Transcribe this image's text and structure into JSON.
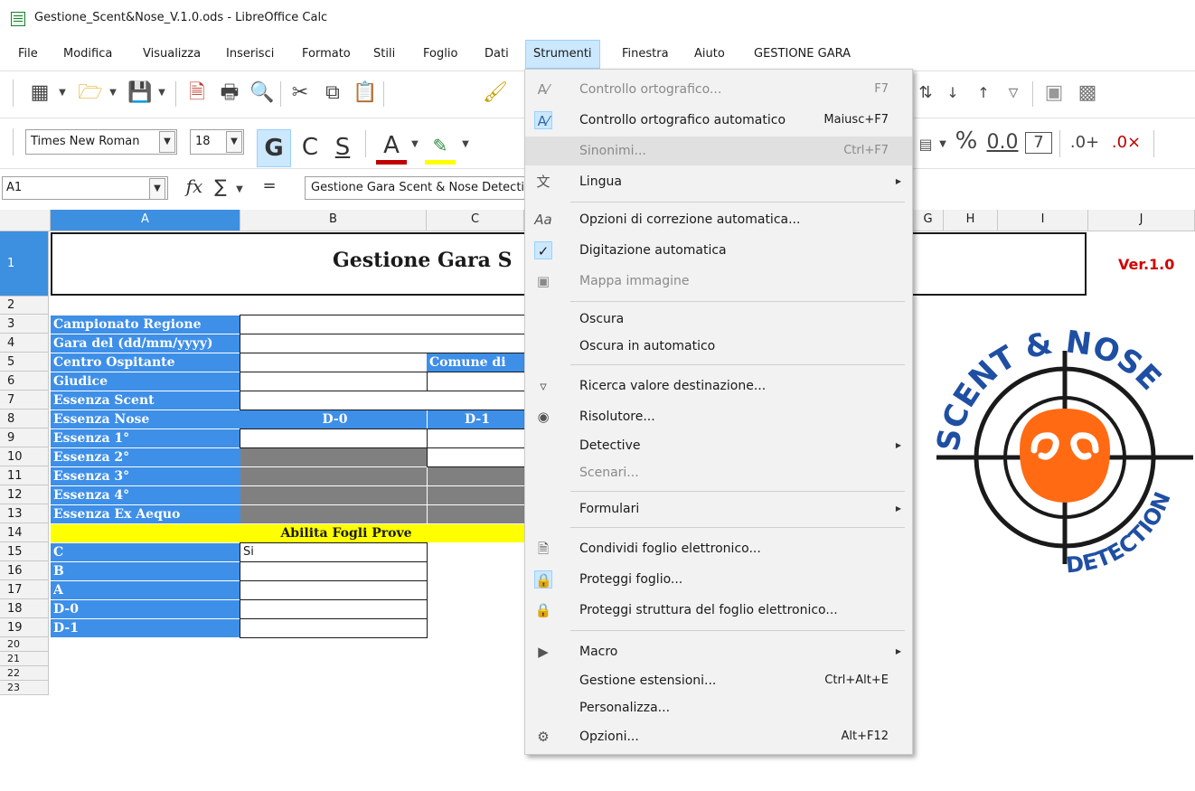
{
  "window": {
    "title": "Gestione_Scent&Nose_V.1.0.ods - LibreOffice Calc"
  },
  "menubar": [
    "File",
    "Modifica",
    "Visualizza",
    "Inserisci",
    "Formato",
    "Stili",
    "Foglio",
    "Dati",
    "Strumenti",
    "Finestra",
    "Aiuto",
    "GESTIONE GARA"
  ],
  "toolbar": {
    "font_name": "Times New Roman",
    "font_size": "18",
    "bold_label": "G",
    "italic_label": "C",
    "underline_label": "S",
    "percent_label": "%",
    "decimal_label": "0.0"
  },
  "formula_bar": {
    "cell_ref": "A1",
    "content": "Gestione Gara Scent & Nose Detection"
  },
  "columns": [
    "A",
    "B",
    "C",
    "G",
    "H",
    "I",
    "J"
  ],
  "rows": [
    "1",
    "2",
    "3",
    "4",
    "5",
    "6",
    "7",
    "8",
    "9",
    "10",
    "11",
    "12",
    "13",
    "14",
    "15",
    "16",
    "17",
    "18",
    "19",
    "20",
    "21",
    "22",
    "23"
  ],
  "sheet": {
    "title": "Gestione Gara S",
    "version": "Ver.1.0",
    "labels": {
      "r3": "Campionato Regione",
      "r4": "Gara del (dd/mm/yyyy)",
      "r5": "Centro Ospitante",
      "r5c": "Comune di",
      "r6": "Giudice",
      "r7": "Essenza Scent",
      "r8": "Essenza Nose",
      "r8b": "D-0",
      "r8c": "D-1",
      "r9": "Essenza 1°",
      "r10": "Essenza 2°",
      "r11": "Essenza 3°",
      "r12": "Essenza 4°",
      "r13": "Essenza Ex Aequo",
      "r14": "Abilita Fogli Prove",
      "r15": "C",
      "r15b": "Si",
      "r16": "B",
      "r17": "A",
      "r18": "D-0",
      "r19": "D-1"
    }
  },
  "logo": {
    "top_text": "SCENT & NOSE",
    "bottom_text": "DETECTION",
    "accent": "#ff6a13",
    "text_color": "#1f4fa3"
  },
  "tools_menu": {
    "items": [
      {
        "label": "Controllo ortografico...",
        "shortcut": "F7",
        "disabled": false
      },
      {
        "label": "Controllo ortografico automatico",
        "shortcut": "Maiusc+F7",
        "disabled": false
      },
      {
        "label": "Sinonimi...",
        "shortcut": "Ctrl+F7",
        "disabled": true
      },
      {
        "label": "Lingua",
        "shortcut": "",
        "disabled": false
      },
      {
        "label": "Opzioni di correzione automatica...",
        "shortcut": "",
        "disabled": false
      },
      {
        "label": "Digitazione automatica",
        "shortcut": "",
        "disabled": false
      },
      {
        "label": "Mappa immagine",
        "shortcut": "",
        "disabled": true
      },
      {
        "label": "Oscura",
        "shortcut": "",
        "disabled": false
      },
      {
        "label": "Oscura in automatico",
        "shortcut": "",
        "disabled": false
      },
      {
        "label": "Ricerca valore destinazione...",
        "shortcut": "",
        "disabled": false
      },
      {
        "label": "Risolutore...",
        "shortcut": "",
        "disabled": false
      },
      {
        "label": "Detective",
        "shortcut": "",
        "disabled": false
      },
      {
        "label": "Scenari...",
        "shortcut": "",
        "disabled": true
      },
      {
        "label": "Formulari",
        "shortcut": "",
        "disabled": false
      },
      {
        "label": "Condividi foglio elettronico...",
        "shortcut": "",
        "disabled": false
      },
      {
        "label": "Proteggi foglio...",
        "shortcut": "",
        "disabled": false
      },
      {
        "label": "Proteggi struttura del foglio elettronico...",
        "shortcut": "",
        "disabled": false
      },
      {
        "label": "Macro",
        "shortcut": "",
        "disabled": false
      },
      {
        "label": "Gestione estensioni...",
        "shortcut": "Ctrl+Alt+E",
        "disabled": false
      },
      {
        "label": "Personalizza...",
        "shortcut": "",
        "disabled": false
      },
      {
        "label": "Opzioni...",
        "shortcut": "Alt+F12",
        "disabled": false
      }
    ]
  },
  "colors": {
    "cell_blue": "#3e8fe8",
    "cell_gray": "#808080",
    "cell_yellow": "#ffff00",
    "version_red": "#d00000",
    "menu_highlight": "#cce8ff"
  }
}
